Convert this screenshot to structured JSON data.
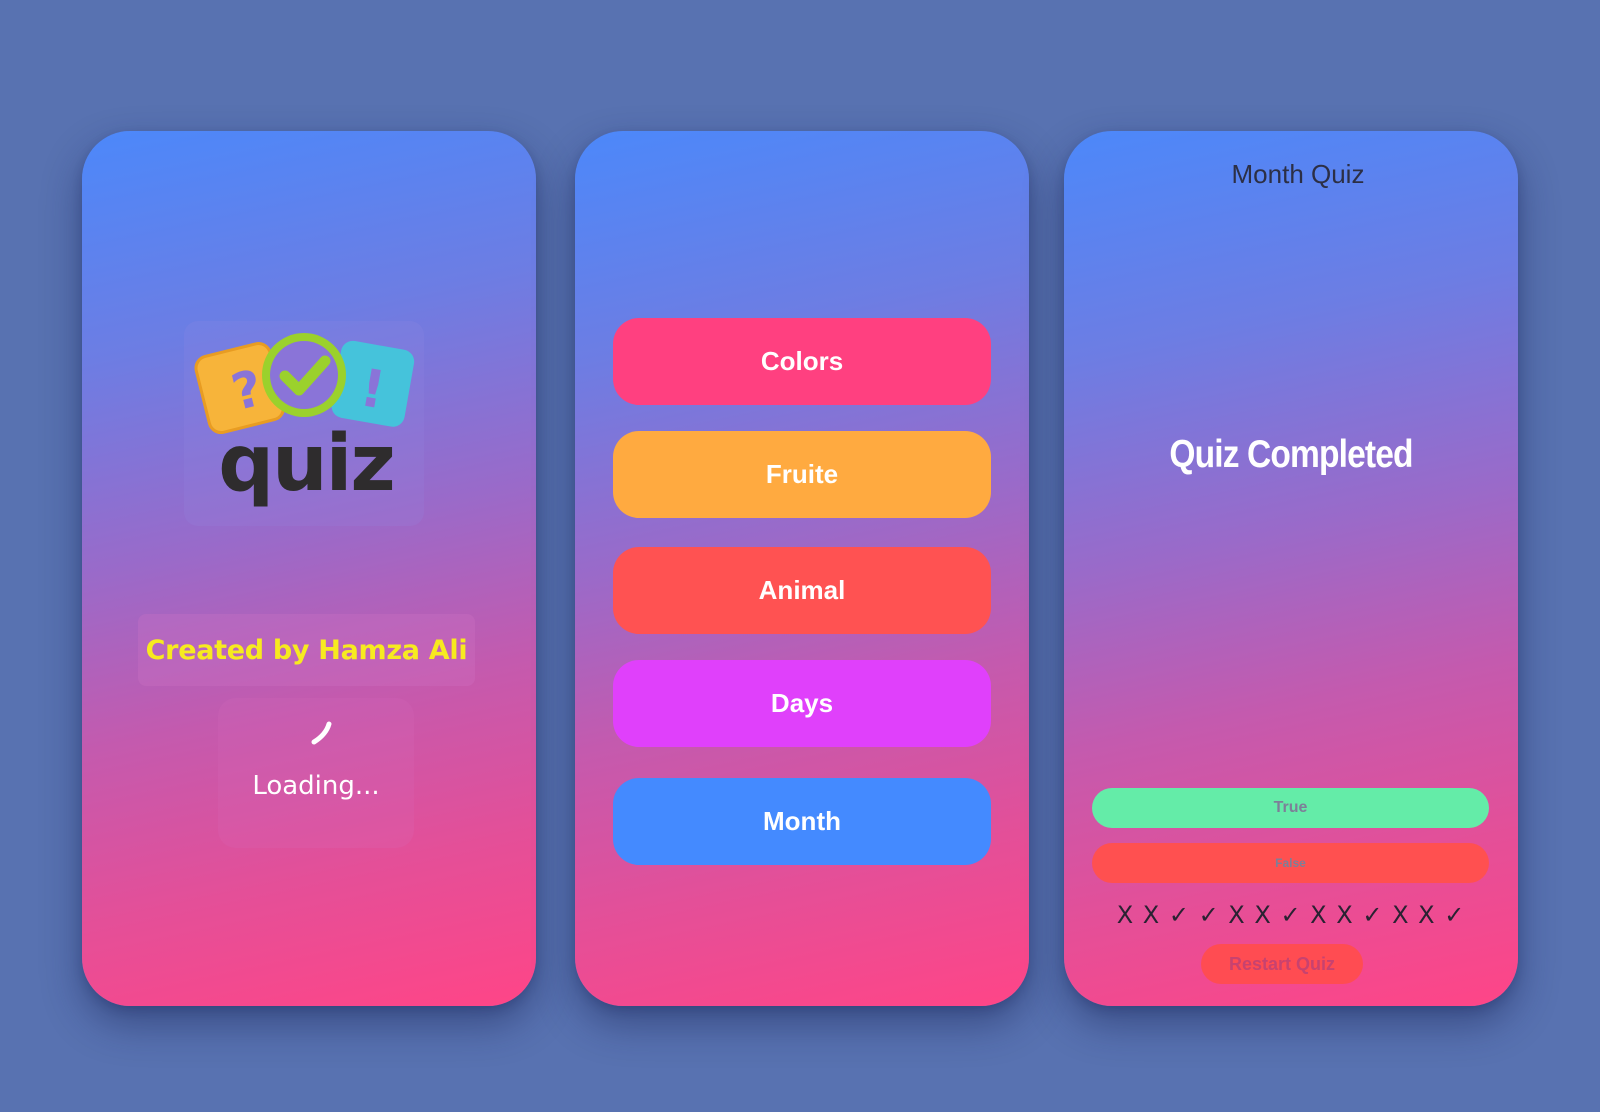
{
  "splash": {
    "logo_text": "quiz",
    "credit": "Created by Hamza Ali",
    "loading": "Loading..."
  },
  "categories": {
    "items": [
      {
        "label": "Colors",
        "color": "#ff4080"
      },
      {
        "label": "Fruite",
        "color": "#ffaa40"
      },
      {
        "label": "Animal",
        "color": "#ff5252"
      },
      {
        "label": "Days",
        "color": "#e040fb"
      },
      {
        "label": "Month",
        "color": "#448aff"
      }
    ]
  },
  "result": {
    "title": "Month Quiz",
    "heading": "Quiz Completed",
    "true_label": "True",
    "false_label": "False",
    "score_marks": "X X ✓ ✓ X X ✓ X X ✓ X X ✓",
    "restart_label": "Restart Quiz"
  },
  "colors": {
    "page_background": "#5872b1",
    "gradient_top": "#4c88fa",
    "gradient_bottom": "#ff4587",
    "credit_text": "#f7ea1f",
    "true_button": "#64eca8",
    "false_button": "#ff5050",
    "restart_button": "#ff4c52"
  },
  "icons": {
    "logo": [
      "question-mark-tile-icon",
      "checkmark-circle-icon",
      "exclamation-tile-icon"
    ],
    "loader": "spinner-icon"
  }
}
